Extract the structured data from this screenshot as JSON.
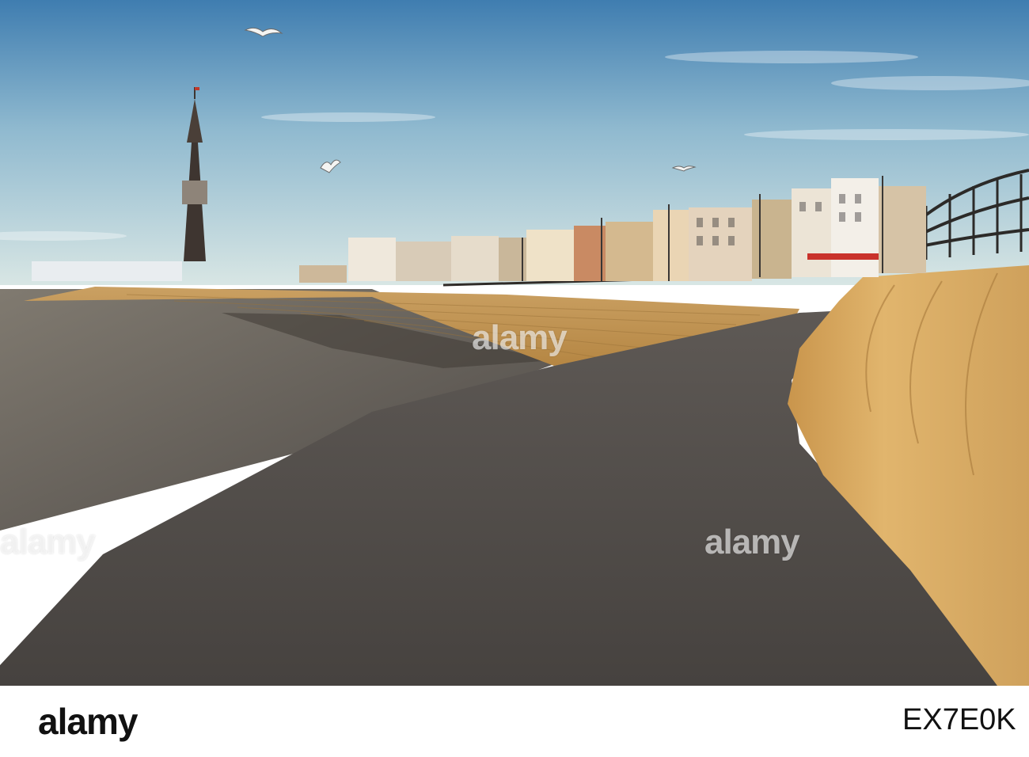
{
  "watermark": {
    "text": "alamy"
  },
  "footer": {
    "brand": "alamy",
    "image_id": "EX7E0K",
    "image_id_label": "",
    "url": ""
  },
  "colors": {
    "sky_top": "#3f7fb3",
    "sky_bottom": "#cde0e6",
    "sand": "#6f6a63",
    "promenade": "#4f4b48",
    "sea_wall": "#d3a563"
  }
}
